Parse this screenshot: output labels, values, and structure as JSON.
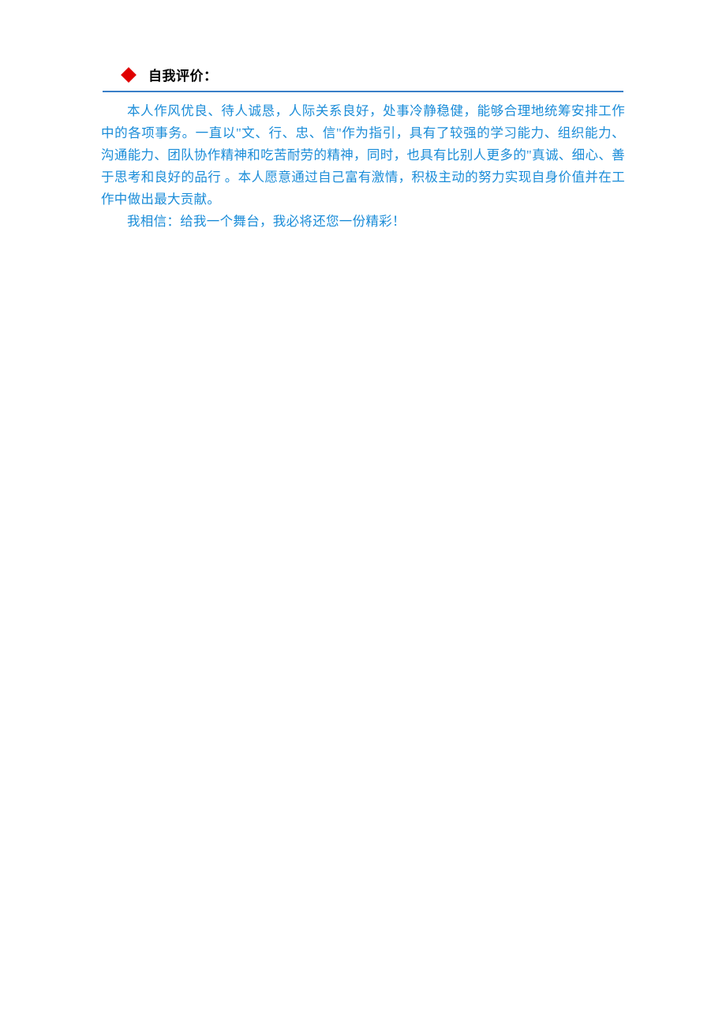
{
  "section": {
    "title": "自我评价：",
    "paragraphs": [
      "本人作风优良、待人诚恳，人际关系良好，处事冷静稳健，能够合理地统筹安排工作中的各项事务。一直以\"文、行、忠、信\"作为指引，具有了较强的学习能力、组织能力、沟通能力、团队协作精神和吃苦耐劳的精神，同时，也具有比别人更多的\"真诚、细心、善于思考和良好的品行 。本人愿意通过自己富有激情，积极主动的努力实现自身价值并在工作中做出最大贡献。",
      "我相信：给我一个舞台，我必将还您一份精彩！"
    ]
  }
}
